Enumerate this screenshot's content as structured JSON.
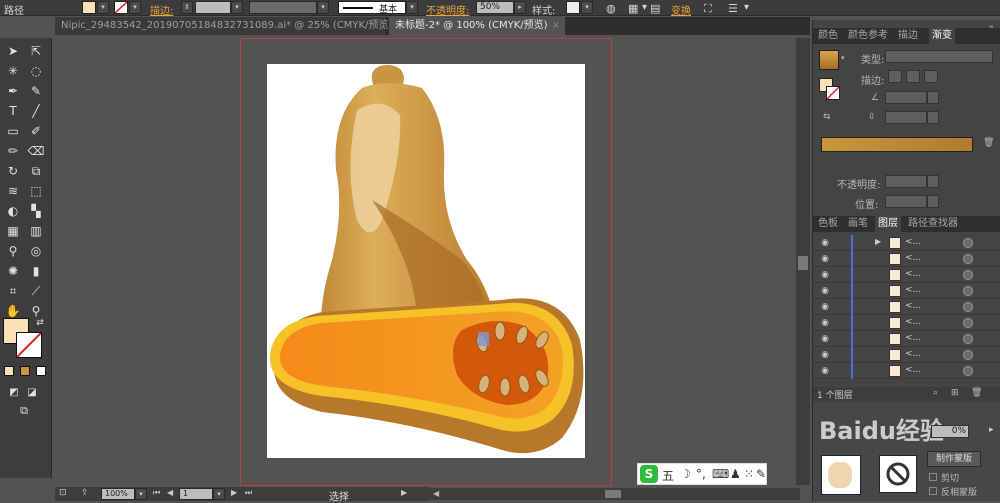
{
  "control_bar": {
    "mode_label": "路径",
    "stroke_label": "描边:",
    "stroke_style": "基本",
    "opacity_label": "不透明度:",
    "opacity_value": "50%",
    "style_label": "样式:",
    "transform_label": "变换"
  },
  "tabs": [
    {
      "label": "Nipic_29483542_20190705184832731089.ai* @ 25% (CMYK/预览)",
      "close": "×"
    },
    {
      "label": "未标题-2* @ 100% (CMYK/预览)",
      "close": "×"
    }
  ],
  "status": {
    "zoom": "100%",
    "page": "1",
    "tool": "选择"
  },
  "panels": {
    "top_tabs": [
      "颜色",
      "颜色参考",
      "描边",
      "渐变"
    ],
    "gradient": {
      "type_label": "类型:",
      "stroke_label": "描边:",
      "opacity_label": "不透明度:",
      "position_label": "位置:"
    },
    "mid_tabs": [
      "色板",
      "画笔",
      "图层",
      "路径查找器"
    ],
    "layers": [
      {
        "name": "<..."
      },
      {
        "name": "<..."
      },
      {
        "name": "<..."
      },
      {
        "name": "<..."
      },
      {
        "name": "<..."
      },
      {
        "name": "<..."
      },
      {
        "name": "<..."
      },
      {
        "name": "<..."
      },
      {
        "name": "<..."
      }
    ],
    "layer_count": "1 个图层",
    "bottom": {
      "watermark": "Baidu经验",
      "make_mask": "制作蒙版",
      "clip": "剪切",
      "invert_mask": "反相蒙版",
      "opacity_value": "0%"
    }
  },
  "ime": {
    "logo": "S",
    "lang": "五"
  },
  "colors": {
    "accent": "#e7a43a",
    "fill_swatch": "#fbe2b4",
    "gradient_start": "#c8963c",
    "gradient_end": "#b37a30",
    "bleed": "#b2403c",
    "layer_bar": "#4a6fd6"
  }
}
